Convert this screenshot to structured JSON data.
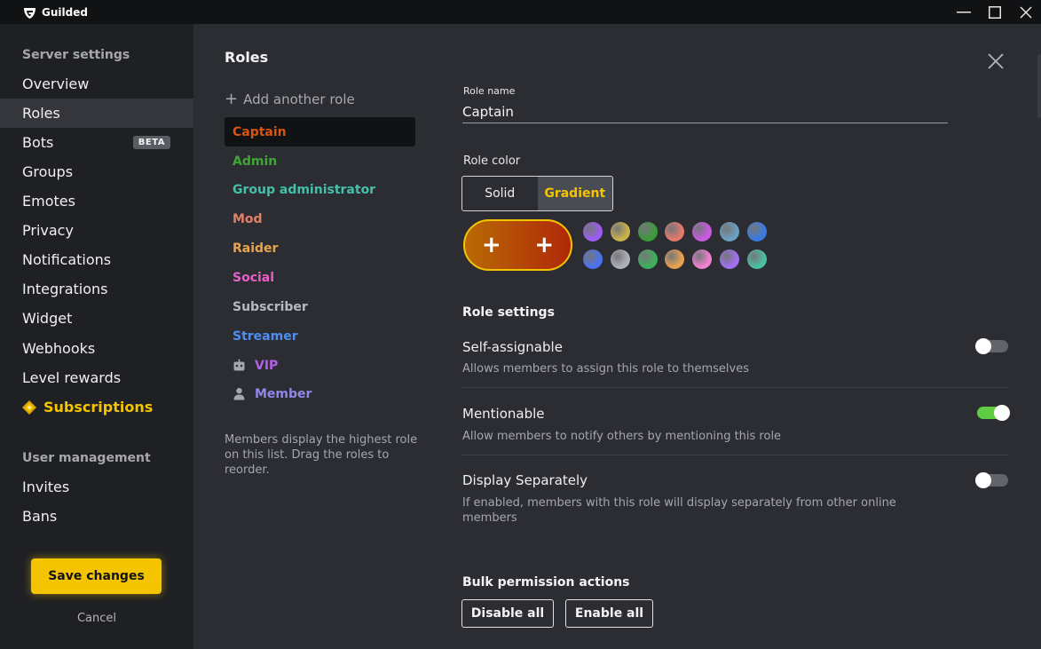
{
  "app": {
    "name": "Guilded"
  },
  "sidebar": {
    "server_settings_label": "Server settings",
    "items": [
      {
        "label": "Overview"
      },
      {
        "label": "Roles"
      },
      {
        "label": "Bots",
        "badge": "BETA"
      },
      {
        "label": "Groups"
      },
      {
        "label": "Emotes"
      },
      {
        "label": "Privacy"
      },
      {
        "label": "Notifications"
      },
      {
        "label": "Integrations"
      },
      {
        "label": "Widget"
      },
      {
        "label": "Webhooks"
      },
      {
        "label": "Level rewards"
      },
      {
        "label": "Subscriptions"
      }
    ],
    "user_management_label": "User management",
    "user_items": [
      {
        "label": "Invites"
      },
      {
        "label": "Bans"
      }
    ],
    "save_label": "Save changes",
    "cancel_label": "Cancel"
  },
  "roles": {
    "title": "Roles",
    "add_label": "Add another role",
    "list": [
      {
        "name": "Captain",
        "color": "#d9540f"
      },
      {
        "name": "Admin",
        "color": "#3fa635"
      },
      {
        "name": "Group administrator",
        "color": "#44c0a8"
      },
      {
        "name": "Mod",
        "color": "#e0826a"
      },
      {
        "name": "Raider",
        "color": "#e8a34c"
      },
      {
        "name": "Social",
        "color": "#e85fc8"
      },
      {
        "name": "Subscriber",
        "color": "#b8b9c0"
      },
      {
        "name": "Streamer",
        "color": "#4f8ef0"
      },
      {
        "name": "VIP",
        "color": "#b460e8"
      },
      {
        "name": "Member",
        "color": "#8f88e8"
      }
    ],
    "hint": "Members display the highest role on this list. Drag the roles to reorder."
  },
  "editor": {
    "role_name_label": "Role name",
    "role_name_value": "Captain",
    "role_color_label": "Role color",
    "color_modes": [
      "Solid",
      "Gradient"
    ],
    "selected_mode": "Gradient",
    "gradient": {
      "from": "#b86a05",
      "to": "#b02808"
    },
    "swatches": [
      [
        "#9b5cf0",
        "#c9b24a",
        "#3c9a3a",
        "#e27a6a",
        "#c85ae0",
        "#6aa0c0",
        "#3a7ae0"
      ],
      [
        "#4a72f0",
        "#b0b0b8",
        "#3fae5a",
        "#e8a050",
        "#f080d0",
        "#a070f0",
        "#4cc0a0"
      ]
    ],
    "role_settings_label": "Role settings",
    "settings": [
      {
        "title": "Self-assignable",
        "desc": "Allows members to assign this role to themselves",
        "enabled": false
      },
      {
        "title": "Mentionable",
        "desc": "Allow members to notify others by mentioning this role",
        "enabled": true
      },
      {
        "title": "Display Separately",
        "desc": "If enabled, members with this role will display separately from other online members",
        "enabled": false
      }
    ],
    "bulk_label": "Bulk permission actions",
    "disable_all_label": "Disable all",
    "enable_all_label": "Enable all"
  },
  "colors": {
    "accent": "#f5c400",
    "toggle_on": "#5fcd43",
    "sidebar_bg": "#1f2024",
    "main_bg": "#2b2d33"
  }
}
